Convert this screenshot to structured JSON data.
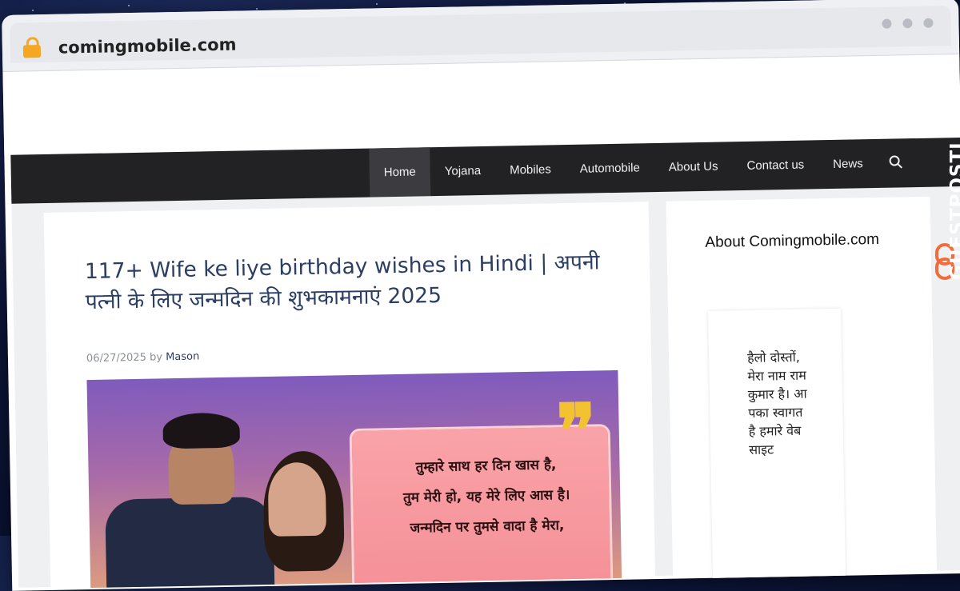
{
  "browser": {
    "domain": "comingmobile.com"
  },
  "nav": {
    "items": [
      "Home",
      "Yojana",
      "Mobiles",
      "Automobile",
      "About Us",
      "Contact us",
      "News"
    ],
    "active_index": 0,
    "search_icon": "search-icon"
  },
  "article": {
    "title": "117+ Wife ke liye birthday wishes in Hindi | अपनी पत्नी के लिए जन्मदिन की शुभकामनाएं 2025",
    "date": "06/27/2025",
    "by": "by",
    "author": "Mason",
    "image_lines": [
      "तुम्हारे साथ हर दिन खास है,",
      "तुम मेरी हो, यह मेरे लिए आस है।",
      "जन्मदिन पर तुमसे वादा है मेरा,"
    ]
  },
  "sidebar": {
    "title": "About Comingmobile.com",
    "text": "हैलो दोस्तों, मेरा नाम राम कुमार है। आपका स्वागत है हमारे वेबसाइट"
  },
  "badge": {
    "text": "GUESTPOSTLINKS"
  },
  "colors": {
    "navbar": "#222225",
    "title": "#2b3e63",
    "badge_accent": "#f26b3a"
  }
}
